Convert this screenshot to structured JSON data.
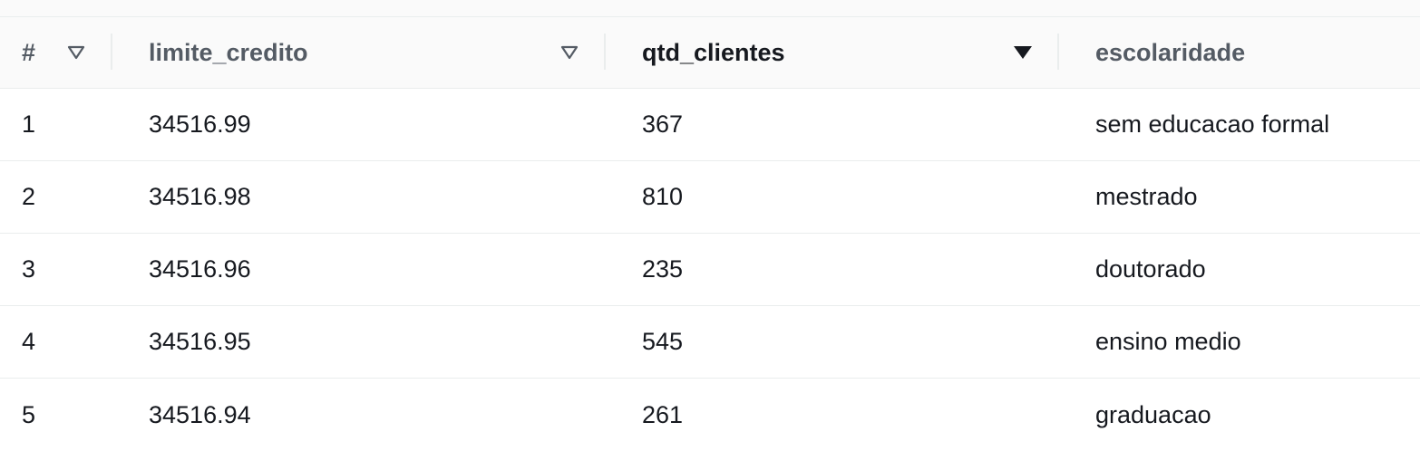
{
  "table": {
    "columns": [
      {
        "label": "#",
        "sort": "none"
      },
      {
        "label": "limite_credito",
        "sort": "none"
      },
      {
        "label": "qtd_clientes",
        "sort": "descending"
      },
      {
        "label": "escolaridade",
        "sort": "none"
      }
    ],
    "rows": [
      {
        "idx": "1",
        "limite_credito": "34516.99",
        "qtd_clientes": "367",
        "escolaridade": "sem educacao formal"
      },
      {
        "idx": "2",
        "limite_credito": "34516.98",
        "qtd_clientes": "810",
        "escolaridade": "mestrado"
      },
      {
        "idx": "3",
        "limite_credito": "34516.96",
        "qtd_clientes": "235",
        "escolaridade": "doutorado"
      },
      {
        "idx": "4",
        "limite_credito": "34516.95",
        "qtd_clientes": "545",
        "escolaridade": "ensino medio"
      },
      {
        "idx": "5",
        "limite_credito": "34516.94",
        "qtd_clientes": "261",
        "escolaridade": "graduacao"
      }
    ]
  },
  "colors": {
    "header_bg": "#fafafa",
    "border": "#eaeded",
    "header_text": "#545b64",
    "text": "#16191f"
  },
  "icons": {
    "sort_inactive": "sort-outline-triangle-icon",
    "sort_active": "sort-filled-triangle-down-icon"
  }
}
